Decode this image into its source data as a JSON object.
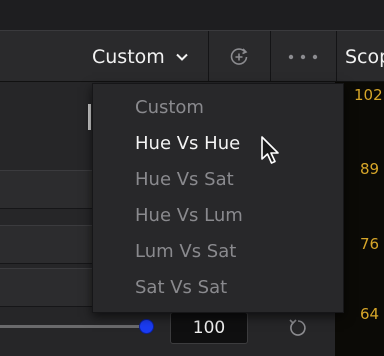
{
  "header": {
    "mode_label": "Custom",
    "scopes_label": "Scopes"
  },
  "dropdown": {
    "items": [
      {
        "label": "Custom",
        "state": "disabled"
      },
      {
        "label": "Hue Vs Hue",
        "state": "highlighted"
      },
      {
        "label": "Hue Vs Sat",
        "state": "normal"
      },
      {
        "label": "Hue Vs Lum",
        "state": "normal"
      },
      {
        "label": "Lum Vs Sat",
        "state": "normal"
      },
      {
        "label": "Sat Vs Sat",
        "state": "normal"
      }
    ]
  },
  "scope": {
    "scale_labels": [
      "102",
      "89",
      "76",
      "64"
    ],
    "accent_color": "#d7a629"
  },
  "controls": {
    "value": "100",
    "slider_color": "#1b3cf2"
  },
  "icons": {
    "mode_dropdown": "chevron-down-icon",
    "add": "add-circle-icon",
    "more": "more-horizontal-icon",
    "reset": "reset-icon",
    "pointer": "mouse-cursor-icon"
  }
}
